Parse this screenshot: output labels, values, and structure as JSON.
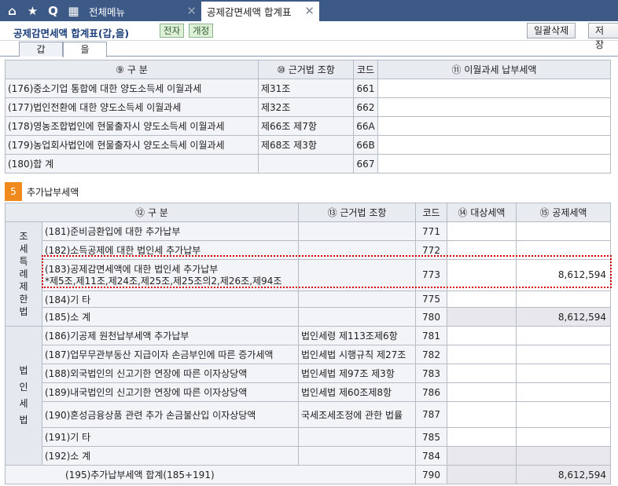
{
  "topbar": {
    "icons": [
      "home-icon",
      "star-icon",
      "search-icon",
      "calendar-icon"
    ],
    "icon_glyphs": [
      "⌂",
      "★",
      "Q",
      "▦"
    ],
    "menu_tab": "전체메뉴",
    "active_tab": "공제감면세액 합계표",
    "close_glyph": "✕",
    "bg_color": "#3d5a86"
  },
  "title": {
    "text": "공제감면세액 합계표(갑,을)",
    "badge_electronic": "전자",
    "badge_revised": "개정",
    "btn_bulk_delete": "일괄삭제",
    "btn_save": "저장"
  },
  "subtabs": [
    "갑",
    "을"
  ],
  "table1": {
    "headers": [
      "⑨ 구          분",
      "⑩ 근거법 조항",
      "코드",
      "⑪ 이월과세 납부세액"
    ],
    "rows": [
      {
        "label": "(176)중소기업 통합에 대한 양도소득세 이월과세",
        "law": "제31조",
        "code": "661",
        "amount": ""
      },
      {
        "label": "(177)법인전환에 대한 양도소득세 이월과세",
        "law": "제32조",
        "code": "662",
        "amount": ""
      },
      {
        "label": "(178)영농조합법인에 현물출자시 양도소득세 이월과세",
        "law": "제66조 제7항",
        "code": "66A",
        "amount": ""
      },
      {
        "label": "(179)농업회사법인에 현물출자시 양도소득세 이월과세",
        "law": "제68조 제3항",
        "code": "66B",
        "amount": ""
      },
      {
        "label": "(180)합       계",
        "law": "",
        "code": "667",
        "amount": ""
      }
    ]
  },
  "section5": {
    "number": "5",
    "title": "추가납부세액",
    "accent": "#f08a1c"
  },
  "table2": {
    "headers": [
      "⑫ 구          분",
      "⑬ 근거법 조항",
      "코드",
      "⑭ 대상세액",
      "⑮ 공제세액"
    ],
    "group1_label": "조세특례제한법",
    "group2_label": "법인세법",
    "rows_group1": [
      {
        "label": "(181)준비금환입에 대한 추가납부",
        "law": "",
        "code": "771",
        "target": "",
        "credit": ""
      },
      {
        "label": "(182)소득공제에 대한 법인세 추가납부",
        "law": "",
        "code": "772",
        "target": "",
        "credit": ""
      },
      {
        "label": "(183)공제감면세액에 대한 법인세 추가납부",
        "label2": "*제5조,제11조,제24조,제25조,제25조의2,제26조,제94조",
        "law": "",
        "code": "773",
        "target": "",
        "credit": "8,612,594"
      },
      {
        "label": "(184)기       타",
        "law": "",
        "code": "775",
        "target": "",
        "credit": ""
      },
      {
        "label": "(185)소       계",
        "law": "",
        "code": "780",
        "target": "",
        "credit": "8,612,594"
      }
    ],
    "rows_group2": [
      {
        "label": "(186)기공제 원천납부세액 추가납부",
        "law": "법인세령 제113조제6항",
        "code": "781",
        "target": "",
        "credit": ""
      },
      {
        "label": "(187)업무무관부동산 지급이자 손금부인에 따른 증가세액",
        "law": "법인세법 시행규칙 제27조",
        "code": "782",
        "target": "",
        "credit": ""
      },
      {
        "label": "(188)외국법인의 신고기한 연장에 따른 이자상당액",
        "law": "법인세법 제97조 제3항",
        "code": "783",
        "target": "",
        "credit": ""
      },
      {
        "label": "(189)내국법인의 신고기한 연장에 따른 이자상당액",
        "law": "법인세법 제60조제8항",
        "code": "786",
        "target": "",
        "credit": ""
      },
      {
        "label": "(190)혼성금융상품 관련 추가 손금불산입 이자상당액",
        "law": "국세조세조정에 관한 법률",
        "code": "787",
        "target": "",
        "credit": ""
      },
      {
        "label": "(191)기       타",
        "law": "",
        "code": "785",
        "target": "",
        "credit": ""
      },
      {
        "label": "(192)소       계",
        "law": "",
        "code": "784",
        "target": "",
        "credit": ""
      }
    ],
    "total": {
      "label": "(195)추가납부세액 합계(185+191)",
      "code": "790",
      "target": "",
      "credit": "8,612,594"
    }
  }
}
